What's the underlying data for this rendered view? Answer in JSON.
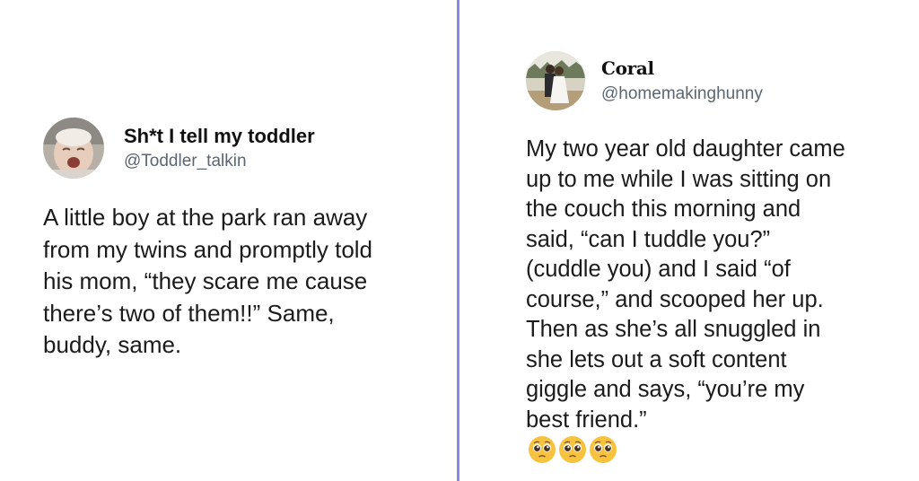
{
  "left_tweet": {
    "display_name": "Sh*t I tell my toddler",
    "handle": "@Toddler_talkin",
    "text": "A little boy at the park ran away\nfrom my twins and promptly told\nhis mom, “they scare me cause\nthere’s two of them!!” Same,\nbuddy, same.",
    "avatar_icon": "crying-baby-photo"
  },
  "right_tweet": {
    "display_name": "Coral",
    "handle": "@homemakinghunny",
    "text": "My two year old daughter came\nup to me while I was sitting on\nthe couch this morning and\nsaid, “can I tuddle you?”\n(cuddle you) and I said “of\ncourse,” and scooped her up.\nThen as she’s all snuggled in\nshe lets out a soft content\ngiggle and says, “you’re my\nbest friend.”",
    "emoji_icon": "pleading-face-emoji",
    "emoji_count": 3,
    "avatar_icon": "wedding-couple-photo"
  },
  "colors": {
    "divider": "#8a87ea",
    "handle": "#5b6670",
    "text": "#1b1b1b"
  }
}
